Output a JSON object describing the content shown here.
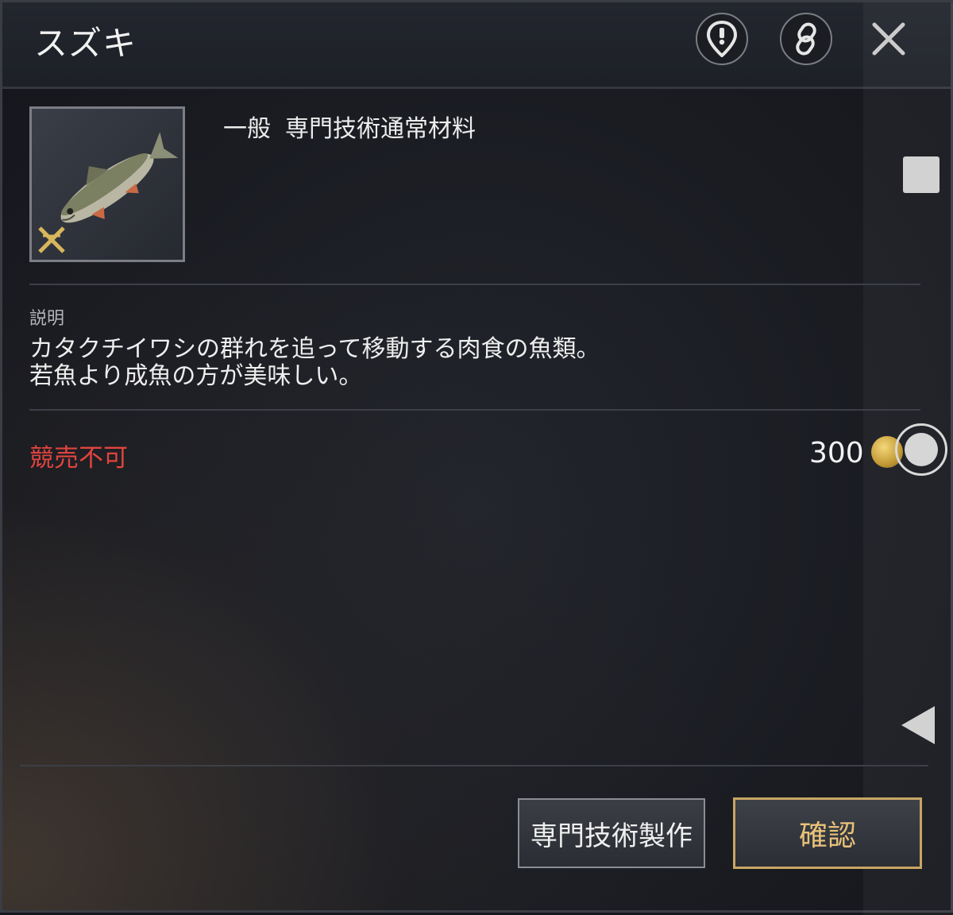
{
  "window": {
    "title": "スズキ"
  },
  "header": {
    "pin_icon": "location-pin-alert-icon",
    "link_icon": "chain-link-icon",
    "close_icon": "close-x-icon"
  },
  "item": {
    "image": "sea-bass-fish-icon",
    "grade": "一般",
    "category": "専門技術通常材料"
  },
  "description": {
    "label": "説明",
    "line1": "カタクチイワシの群れを追って移動する肉食の魚類。",
    "line2": "若魚より成魚の方が美味しい。"
  },
  "trade": {
    "auction_status": "競売不可",
    "price": "300",
    "currency_icon": "gold-coin-icon"
  },
  "buttons": {
    "craft_label": "専門技術製作",
    "confirm_label": "確認"
  },
  "colors": {
    "auction_status": "#e0443e",
    "confirm_border": "#c8a664",
    "confirm_text": "#e9c27a"
  }
}
